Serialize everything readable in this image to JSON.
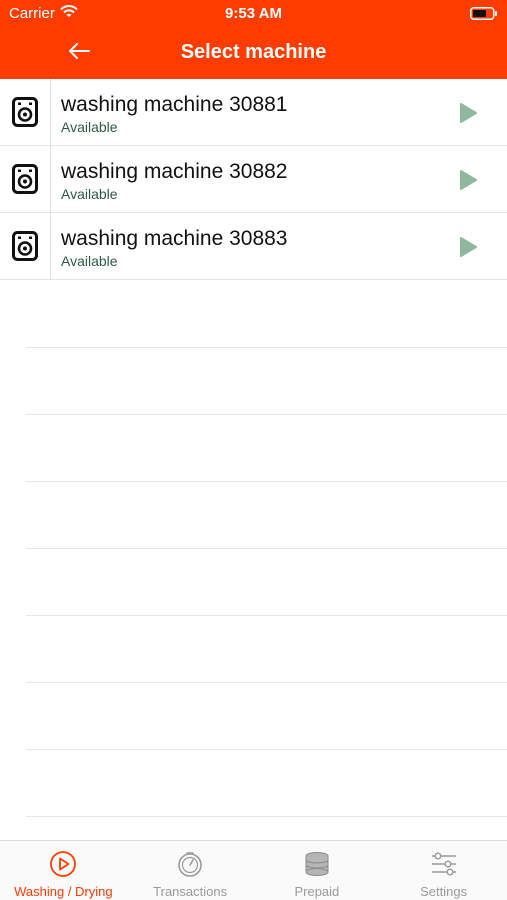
{
  "status_bar": {
    "carrier": "Carrier",
    "time": "9:53 AM"
  },
  "header": {
    "title": "Select machine",
    "back_icon": "arrow-left-icon"
  },
  "machines": [
    {
      "name": "washing machine 30881",
      "status": "Available"
    },
    {
      "name": "washing machine 30882",
      "status": "Available"
    },
    {
      "name": "washing machine 30883",
      "status": "Available"
    }
  ],
  "tabs": [
    {
      "label": "Washing / Drying",
      "icon": "play-circle-icon",
      "active": true
    },
    {
      "label": "Transactions",
      "icon": "clock-icon",
      "active": false
    },
    {
      "label": "Prepaid",
      "icon": "coins-icon",
      "active": false
    },
    {
      "label": "Settings",
      "icon": "sliders-icon",
      "active": false
    }
  ],
  "colors": {
    "accent": "#ff3c00",
    "available": "#2e5a44",
    "play": "#8fb89d",
    "inactive_tab": "#9a9a9a"
  }
}
